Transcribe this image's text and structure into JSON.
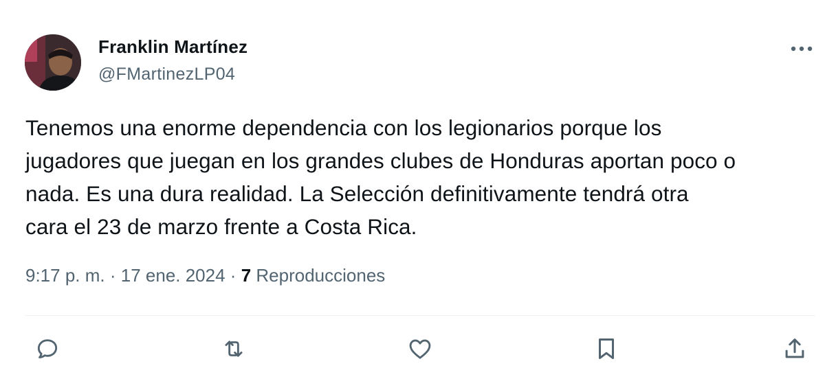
{
  "tweet": {
    "author": {
      "name": "Franklin Martínez",
      "handle": "@FMartinezLP04"
    },
    "text_lines": [
      "Tenemos una enorme dependencia con los legionarios porque los",
      "jugadores que juegan en los grandes clubes de Honduras aportan poco o",
      "nada. Es una dura realidad. La Selección definitivamente tendrá otra",
      "cara el 23 de marzo frente a Costa Rica."
    ],
    "meta": {
      "time": "9:17 p. m.",
      "separator": "·",
      "date": "17 ene. 2024",
      "views_count": "7",
      "views_label": "Reproducciones"
    },
    "actions": [
      {
        "name": "reply",
        "icon": "reply-icon"
      },
      {
        "name": "retweet",
        "icon": "retweet-icon"
      },
      {
        "name": "like",
        "icon": "heart-icon"
      },
      {
        "name": "bookmark",
        "icon": "bookmark-icon"
      },
      {
        "name": "share",
        "icon": "share-icon"
      }
    ],
    "more_icon": "more-options-icon",
    "colors": {
      "text": "#0f1419",
      "secondary": "#536471",
      "divider": "#eff3f4"
    }
  }
}
